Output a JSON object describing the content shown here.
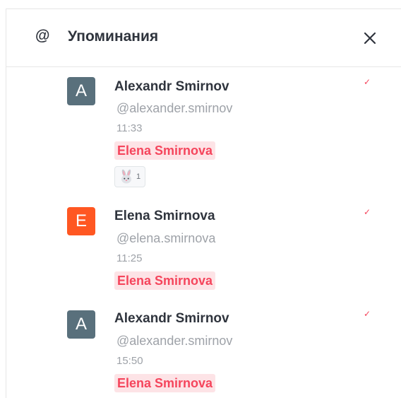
{
  "header": {
    "icon": "@",
    "title": "Упоминания"
  },
  "messages": [
    {
      "avatar_letter": "A",
      "avatar_color": "#59707c",
      "name": "Alexandr Smirnov",
      "username": "@alexander.smirnov",
      "time": "11:33",
      "mention": "Elena Smirnova",
      "read_mark": "✓",
      "reaction": {
        "emoji": "rabbit-face-icon",
        "count": "1"
      }
    },
    {
      "avatar_letter": "E",
      "avatar_color": "#ff5722",
      "name": "Elena Smirnova",
      "username": "@elena.smirnova",
      "time": "11:25",
      "mention": "Elena Smirnova",
      "read_mark": "✓"
    },
    {
      "avatar_letter": "A",
      "avatar_color": "#59707c",
      "name": "Alexandr Smirnov",
      "username": "@alexander.smirnov",
      "time": "15:50",
      "mention": "Elena Smirnova",
      "read_mark": "✓"
    }
  ],
  "colors": {
    "mention_text": "#f5455c",
    "mention_bg": "#fde3e6",
    "muted": "#9ea2a8",
    "primary_text": "#2f343d"
  }
}
